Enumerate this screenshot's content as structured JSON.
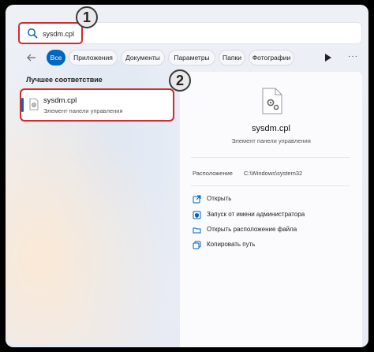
{
  "search": {
    "value": "sysdm.cpl"
  },
  "badges": {
    "one": "1",
    "two": "2"
  },
  "tabs": [
    {
      "label": "Все",
      "active": true
    },
    {
      "label": "Приложения"
    },
    {
      "label": "Документы"
    },
    {
      "label": "Параметры"
    },
    {
      "label": "Папки"
    },
    {
      "label": "Фотографии"
    }
  ],
  "more_label": "···",
  "best_match": {
    "section_title": "Лучшее соответствие",
    "title": "sysdm.cpl",
    "subtitle": "Элемент панели управления"
  },
  "details": {
    "title": "sysdm.cpl",
    "subtitle": "Элемент панели управления",
    "location_label": "Расположение",
    "location_value": "C:\\Windows\\system32",
    "actions": [
      {
        "label": "Открыть",
        "icon": "open-external-icon"
      },
      {
        "label": "Запуск от имени администратора",
        "icon": "shield-icon"
      },
      {
        "label": "Открыть расположение файла",
        "icon": "folder-icon"
      },
      {
        "label": "Копировать путь",
        "icon": "copy-icon"
      }
    ]
  },
  "colors": {
    "accent": "#0067c0",
    "highlight": "#d42b2b"
  }
}
